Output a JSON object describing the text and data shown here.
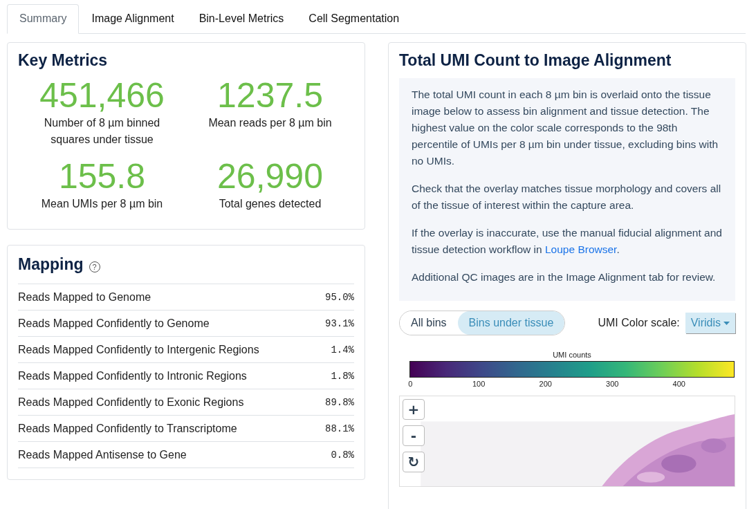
{
  "tabs": [
    {
      "label": "Summary",
      "selected": true
    },
    {
      "label": "Image Alignment",
      "selected": false
    },
    {
      "label": "Bin-Level Metrics",
      "selected": false
    },
    {
      "label": "Cell Segmentation",
      "selected": false
    }
  ],
  "key_metrics": {
    "title": "Key Metrics",
    "metrics": [
      {
        "value": "451,466",
        "label": "Number of 8 µm binned squares under tissue"
      },
      {
        "value": "1237.5",
        "label": "Mean reads per 8 µm bin"
      },
      {
        "value": "155.8",
        "label": "Mean UMIs per 8 µm bin"
      },
      {
        "value": "26,990",
        "label": "Total genes detected"
      }
    ]
  },
  "mapping": {
    "title": "Mapping",
    "help_icon": "?",
    "rows": [
      {
        "label": "Reads Mapped to Genome",
        "value": "95.0%"
      },
      {
        "label": "Reads Mapped Confidently to Genome",
        "value": "93.1%"
      },
      {
        "label": "Reads Mapped Confidently to Intergenic Regions",
        "value": "1.4%"
      },
      {
        "label": "Reads Mapped Confidently to Intronic Regions",
        "value": "1.8%"
      },
      {
        "label": "Reads Mapped Confidently to Exonic Regions",
        "value": "89.8%"
      },
      {
        "label": "Reads Mapped Confidently to Transcriptome",
        "value": "88.1%"
      },
      {
        "label": "Reads Mapped Antisense to Gene",
        "value": "0.8%"
      }
    ]
  },
  "alignment": {
    "title": "Total UMI Count to Image Alignment",
    "paragraphs": [
      {
        "text": "The total UMI count in each 8 µm bin is overlaid onto the tissue image below to assess bin alignment and tissue detection. The highest value on the color scale corresponds to the 98th percentile of UMIs per 8 µm bin under tissue, excluding bins with no UMIs."
      },
      {
        "text": "Check that the overlay matches tissue morphology and covers all of the tissue of interest within the capture area."
      },
      {
        "text": "If the overlay is inaccurate, use the manual fiducial alignment and tissue detection workflow in ",
        "link": "Loupe Browser",
        "after": "."
      },
      {
        "text": "Additional QC images are in the Image Alignment tab for review."
      }
    ],
    "toggle": [
      {
        "label": "All bins",
        "selected": false
      },
      {
        "label": "Bins under tissue",
        "selected": true
      }
    ],
    "color_scale_label": "UMI Color scale:",
    "color_scale_value": "Viridis",
    "colorbar": {
      "title": "UMI counts",
      "ticks": [
        "0",
        "100",
        "200",
        "300",
        "400"
      ]
    },
    "map_controls": [
      "+",
      "-",
      "↻"
    ],
    "image": {
      "kind": "picture"
    }
  }
}
